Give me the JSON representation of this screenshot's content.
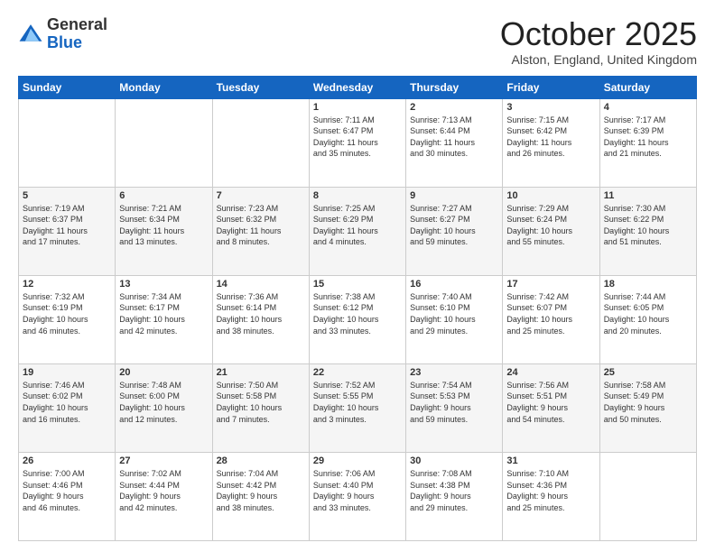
{
  "header": {
    "logo_general": "General",
    "logo_blue": "Blue",
    "month_title": "October 2025",
    "location": "Alston, England, United Kingdom"
  },
  "days_of_week": [
    "Sunday",
    "Monday",
    "Tuesday",
    "Wednesday",
    "Thursday",
    "Friday",
    "Saturday"
  ],
  "weeks": [
    [
      {
        "day": "",
        "info": ""
      },
      {
        "day": "",
        "info": ""
      },
      {
        "day": "",
        "info": ""
      },
      {
        "day": "1",
        "info": "Sunrise: 7:11 AM\nSunset: 6:47 PM\nDaylight: 11 hours\nand 35 minutes."
      },
      {
        "day": "2",
        "info": "Sunrise: 7:13 AM\nSunset: 6:44 PM\nDaylight: 11 hours\nand 30 minutes."
      },
      {
        "day": "3",
        "info": "Sunrise: 7:15 AM\nSunset: 6:42 PM\nDaylight: 11 hours\nand 26 minutes."
      },
      {
        "day": "4",
        "info": "Sunrise: 7:17 AM\nSunset: 6:39 PM\nDaylight: 11 hours\nand 21 minutes."
      }
    ],
    [
      {
        "day": "5",
        "info": "Sunrise: 7:19 AM\nSunset: 6:37 PM\nDaylight: 11 hours\nand 17 minutes."
      },
      {
        "day": "6",
        "info": "Sunrise: 7:21 AM\nSunset: 6:34 PM\nDaylight: 11 hours\nand 13 minutes."
      },
      {
        "day": "7",
        "info": "Sunrise: 7:23 AM\nSunset: 6:32 PM\nDaylight: 11 hours\nand 8 minutes."
      },
      {
        "day": "8",
        "info": "Sunrise: 7:25 AM\nSunset: 6:29 PM\nDaylight: 11 hours\nand 4 minutes."
      },
      {
        "day": "9",
        "info": "Sunrise: 7:27 AM\nSunset: 6:27 PM\nDaylight: 10 hours\nand 59 minutes."
      },
      {
        "day": "10",
        "info": "Sunrise: 7:29 AM\nSunset: 6:24 PM\nDaylight: 10 hours\nand 55 minutes."
      },
      {
        "day": "11",
        "info": "Sunrise: 7:30 AM\nSunset: 6:22 PM\nDaylight: 10 hours\nand 51 minutes."
      }
    ],
    [
      {
        "day": "12",
        "info": "Sunrise: 7:32 AM\nSunset: 6:19 PM\nDaylight: 10 hours\nand 46 minutes."
      },
      {
        "day": "13",
        "info": "Sunrise: 7:34 AM\nSunset: 6:17 PM\nDaylight: 10 hours\nand 42 minutes."
      },
      {
        "day": "14",
        "info": "Sunrise: 7:36 AM\nSunset: 6:14 PM\nDaylight: 10 hours\nand 38 minutes."
      },
      {
        "day": "15",
        "info": "Sunrise: 7:38 AM\nSunset: 6:12 PM\nDaylight: 10 hours\nand 33 minutes."
      },
      {
        "day": "16",
        "info": "Sunrise: 7:40 AM\nSunset: 6:10 PM\nDaylight: 10 hours\nand 29 minutes."
      },
      {
        "day": "17",
        "info": "Sunrise: 7:42 AM\nSunset: 6:07 PM\nDaylight: 10 hours\nand 25 minutes."
      },
      {
        "day": "18",
        "info": "Sunrise: 7:44 AM\nSunset: 6:05 PM\nDaylight: 10 hours\nand 20 minutes."
      }
    ],
    [
      {
        "day": "19",
        "info": "Sunrise: 7:46 AM\nSunset: 6:02 PM\nDaylight: 10 hours\nand 16 minutes."
      },
      {
        "day": "20",
        "info": "Sunrise: 7:48 AM\nSunset: 6:00 PM\nDaylight: 10 hours\nand 12 minutes."
      },
      {
        "day": "21",
        "info": "Sunrise: 7:50 AM\nSunset: 5:58 PM\nDaylight: 10 hours\nand 7 minutes."
      },
      {
        "day": "22",
        "info": "Sunrise: 7:52 AM\nSunset: 5:55 PM\nDaylight: 10 hours\nand 3 minutes."
      },
      {
        "day": "23",
        "info": "Sunrise: 7:54 AM\nSunset: 5:53 PM\nDaylight: 9 hours\nand 59 minutes."
      },
      {
        "day": "24",
        "info": "Sunrise: 7:56 AM\nSunset: 5:51 PM\nDaylight: 9 hours\nand 54 minutes."
      },
      {
        "day": "25",
        "info": "Sunrise: 7:58 AM\nSunset: 5:49 PM\nDaylight: 9 hours\nand 50 minutes."
      }
    ],
    [
      {
        "day": "26",
        "info": "Sunrise: 7:00 AM\nSunset: 4:46 PM\nDaylight: 9 hours\nand 46 minutes."
      },
      {
        "day": "27",
        "info": "Sunrise: 7:02 AM\nSunset: 4:44 PM\nDaylight: 9 hours\nand 42 minutes."
      },
      {
        "day": "28",
        "info": "Sunrise: 7:04 AM\nSunset: 4:42 PM\nDaylight: 9 hours\nand 38 minutes."
      },
      {
        "day": "29",
        "info": "Sunrise: 7:06 AM\nSunset: 4:40 PM\nDaylight: 9 hours\nand 33 minutes."
      },
      {
        "day": "30",
        "info": "Sunrise: 7:08 AM\nSunset: 4:38 PM\nDaylight: 9 hours\nand 29 minutes."
      },
      {
        "day": "31",
        "info": "Sunrise: 7:10 AM\nSunset: 4:36 PM\nDaylight: 9 hours\nand 25 minutes."
      },
      {
        "day": "",
        "info": ""
      }
    ]
  ]
}
